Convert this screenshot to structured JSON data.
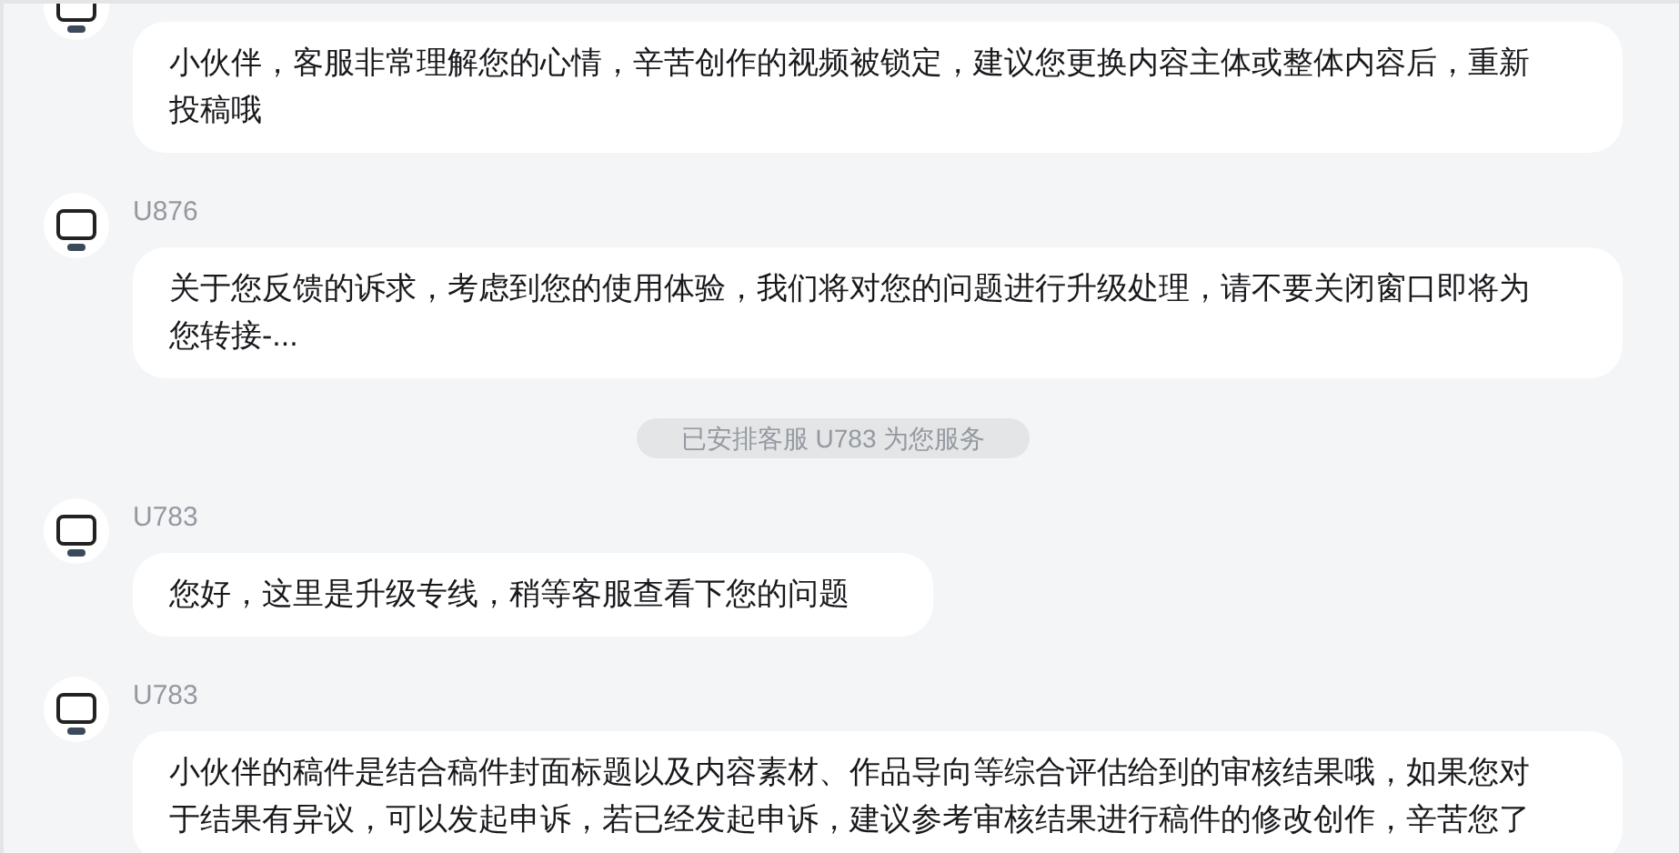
{
  "messages": [
    {
      "kind": "message",
      "text": "小伙伴，客服非常理解您的心情，辛苦创作的视频被锁定，建议您更换内容主体或整体内容后，重新投稿哦"
    },
    {
      "kind": "message",
      "name": "U876",
      "text": "关于您反馈的诉求，考虑到您的使用体验，我们将对您的问题进行升级处理，请不要关闭窗口即将为您转接-..."
    },
    {
      "kind": "notice",
      "text": "已安排客服 U783 为您服务"
    },
    {
      "kind": "message",
      "name": "U783",
      "text": "您好，这里是升级专线，稍等客服查看下您的问题"
    },
    {
      "kind": "message",
      "name": "U783",
      "text": "小伙伴的稿件是结合稿件封面标题以及内容素材、作品导向等综合评估给到的审核结果哦，如果您对于结果有异议，可以发起申诉，若已经发起申诉，建议参考审核结果进行稿件的修改创作，辛苦您了"
    }
  ]
}
